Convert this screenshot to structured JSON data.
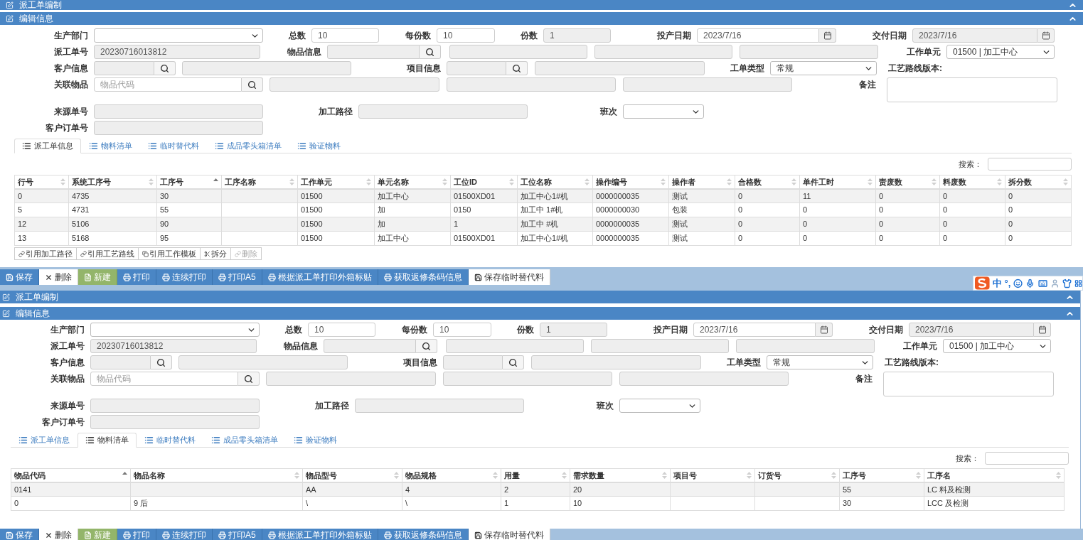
{
  "panels": [
    {
      "title": "派工单编制",
      "section": "编辑信息",
      "form": [
        [
          {
            "kind": "label",
            "text": "生产部门"
          },
          {
            "kind": "select"
          },
          {
            "kind": "label",
            "text": "总数"
          },
          {
            "kind": "input",
            "value": "10",
            "readonly": false
          },
          {
            "kind": "label",
            "text": "每份数"
          },
          {
            "kind": "input",
            "value": "10",
            "readonly": false
          },
          {
            "kind": "label",
            "text": "份数"
          },
          {
            "kind": "input",
            "value": "1",
            "readonly": true
          },
          {
            "kind": "label",
            "text": "投产日期"
          },
          {
            "kind": "date",
            "value": "2023/7/16",
            "readonly": false
          },
          {
            "kind": "label",
            "text": "交付日期"
          },
          {
            "kind": "date",
            "value": "2023/7/16",
            "readonly": true
          }
        ],
        [
          {
            "kind": "label",
            "text": "派工单号"
          },
          {
            "kind": "input",
            "value": "20230716013812",
            "readonly": true
          },
          {
            "kind": "label",
            "text": "物品信息"
          },
          {
            "kind": "lookup",
            "readonly": true
          },
          {
            "kind": "input",
            "readonly": true
          },
          {
            "kind": "input",
            "readonly": true
          },
          {
            "kind": "input",
            "readonly": true
          },
          {
            "kind": "label",
            "text": "工作单元"
          },
          {
            "kind": "select",
            "value": "01500 | 加工中心"
          }
        ],
        [
          {
            "kind": "label",
            "text": "客户信息"
          },
          {
            "kind": "lookup",
            "readonly": true
          },
          {
            "kind": "input",
            "readonly": true
          },
          {
            "kind": "label",
            "text": "项目信息"
          },
          {
            "kind": "lookup",
            "readonly": true
          },
          {
            "kind": "input",
            "readonly": true
          },
          {
            "kind": "label",
            "text": "工单类型"
          },
          {
            "kind": "select",
            "value": "常规"
          },
          {
            "kind": "label",
            "text": "工艺路线版本:"
          }
        ],
        [
          {
            "kind": "label",
            "text": "关联物品"
          },
          {
            "kind": "lookup",
            "placeholder": "物品代码",
            "readonly": false
          },
          {
            "kind": "input",
            "readonly": true
          },
          {
            "kind": "input",
            "readonly": true
          },
          {
            "kind": "input",
            "readonly": true
          },
          {
            "kind": "label",
            "text": "备注"
          },
          {
            "kind": "textarea"
          }
        ],
        [
          {
            "kind": "label",
            "text": "来源单号"
          },
          {
            "kind": "input",
            "readonly": true
          },
          {
            "kind": "label",
            "text": "加工路径"
          },
          {
            "kind": "input",
            "readonly": true
          },
          {
            "kind": "label",
            "text": "班次"
          },
          {
            "kind": "select"
          }
        ],
        [
          {
            "kind": "label",
            "text": "客户订单号"
          },
          {
            "kind": "input",
            "readonly": true
          }
        ]
      ],
      "tabs": [
        {
          "label": "派工单信息",
          "selected": true
        },
        {
          "label": "物料清单",
          "selected": false
        },
        {
          "label": "临时替代料",
          "selected": false
        },
        {
          "label": "成品零头箱清单",
          "selected": false
        },
        {
          "label": "验证物料",
          "selected": false
        }
      ],
      "search_label": "搜索：",
      "table": {
        "columns": [
          {
            "label": "行号",
            "sorted": false
          },
          {
            "label": "系统工序号",
            "sorted": false
          },
          {
            "label": "工序号",
            "sorted": true
          },
          {
            "label": "工序名称",
            "sorted": false
          },
          {
            "label": "工作单元",
            "sorted": false
          },
          {
            "label": "单元名称",
            "sorted": false
          },
          {
            "label": "工位ID",
            "sorted": false
          },
          {
            "label": "工位名称",
            "sorted": false
          },
          {
            "label": "操作编号",
            "sorted": false
          },
          {
            "label": "操作者",
            "sorted": false
          },
          {
            "label": "合格数",
            "sorted": false
          },
          {
            "label": "单件工时",
            "sorted": false
          },
          {
            "label": "责废数",
            "sorted": false
          },
          {
            "label": "料废数",
            "sorted": false
          },
          {
            "label": "拆分数",
            "sorted": false
          }
        ],
        "rows": [
          [
            "0",
            "4735",
            "30",
            "",
            "01500",
            "加工中心",
            "01500XD01",
            "加工中心1#机",
            "0000000035",
            "测试",
            "0",
            "11",
            "0",
            "0",
            "0"
          ],
          [
            "5",
            "4731",
            "55",
            "",
            "01500",
            "加",
            "0150",
            "加工中 1#机",
            "0000000030",
            "包装",
            "0",
            "0",
            "0",
            "0",
            "0"
          ],
          [
            "12",
            "5106",
            "90",
            "",
            "01500",
            "加",
            "1",
            "加工中 #机",
            "0000000035",
            "测试",
            "0",
            "0",
            "0",
            "0",
            "0"
          ],
          [
            "13",
            "5168",
            "95",
            "",
            "01500",
            "加工中心",
            "01500XD01",
            "加工中心1#机",
            "0000000035",
            "测试",
            "0",
            "0",
            "0",
            "0",
            "0"
          ]
        ]
      },
      "actions": [
        {
          "label": "引用加工路径",
          "disabled": false
        },
        {
          "label": "引用工艺路线",
          "disabled": false
        },
        {
          "label": "引用工作模板",
          "disabled": false
        },
        {
          "label": "拆分",
          "disabled": false
        },
        {
          "label": "删除",
          "disabled": true
        }
      ],
      "toolbar": [
        {
          "label": "保存",
          "kind": "primary"
        },
        {
          "label": "删除",
          "kind": "default"
        },
        {
          "label": "新建",
          "kind": "success"
        },
        {
          "label": "打印",
          "kind": "primary"
        },
        {
          "label": "连续打印",
          "kind": "primary"
        },
        {
          "label": "打印A5",
          "kind": "primary"
        },
        {
          "label": "根据派工单打印外箱标贴",
          "kind": "primary"
        },
        {
          "label": "获取返修条码信息",
          "kind": "primary"
        },
        {
          "label": "保存临时替代料",
          "kind": "default"
        }
      ],
      "ime": [
        "中",
        "°,"
      ]
    },
    {
      "title": "派工单编制",
      "section": "编辑信息",
      "form": [
        [
          {
            "kind": "label",
            "text": "生产部门"
          },
          {
            "kind": "select"
          },
          {
            "kind": "label",
            "text": "总数"
          },
          {
            "kind": "input",
            "value": "10",
            "readonly": false
          },
          {
            "kind": "label",
            "text": "每份数"
          },
          {
            "kind": "input",
            "value": "10",
            "readonly": false
          },
          {
            "kind": "label",
            "text": "份数"
          },
          {
            "kind": "input",
            "value": "1",
            "readonly": true
          },
          {
            "kind": "label",
            "text": "投产日期"
          },
          {
            "kind": "date",
            "value": "2023/7/16",
            "readonly": false
          },
          {
            "kind": "label",
            "text": "交付日期"
          },
          {
            "kind": "date",
            "value": "2023/7/16",
            "readonly": true
          }
        ],
        [
          {
            "kind": "label",
            "text": "派工单号"
          },
          {
            "kind": "input",
            "value": "20230716013812",
            "readonly": true
          },
          {
            "kind": "label",
            "text": "物品信息"
          },
          {
            "kind": "lookup",
            "readonly": true
          },
          {
            "kind": "input",
            "readonly": true
          },
          {
            "kind": "input",
            "readonly": true
          },
          {
            "kind": "input",
            "readonly": true
          },
          {
            "kind": "label",
            "text": "工作单元"
          },
          {
            "kind": "select",
            "value": "01500 | 加工中心"
          }
        ],
        [
          {
            "kind": "label",
            "text": "客户信息"
          },
          {
            "kind": "lookup",
            "readonly": true
          },
          {
            "kind": "input",
            "readonly": true
          },
          {
            "kind": "label",
            "text": "项目信息"
          },
          {
            "kind": "lookup",
            "readonly": true
          },
          {
            "kind": "input",
            "readonly": true
          },
          {
            "kind": "label",
            "text": "工单类型"
          },
          {
            "kind": "select",
            "value": "常规"
          },
          {
            "kind": "label",
            "text": "工艺路线版本:"
          }
        ],
        [
          {
            "kind": "label",
            "text": "关联物品"
          },
          {
            "kind": "lookup",
            "placeholder": "物品代码",
            "readonly": false
          },
          {
            "kind": "input",
            "readonly": true
          },
          {
            "kind": "input",
            "readonly": true
          },
          {
            "kind": "input",
            "readonly": true
          },
          {
            "kind": "label",
            "text": "备注"
          },
          {
            "kind": "textarea"
          }
        ],
        [
          {
            "kind": "label",
            "text": "来源单号"
          },
          {
            "kind": "input",
            "readonly": true
          },
          {
            "kind": "label",
            "text": "加工路径"
          },
          {
            "kind": "input",
            "readonly": true
          },
          {
            "kind": "label",
            "text": "班次"
          },
          {
            "kind": "select"
          }
        ],
        [
          {
            "kind": "label",
            "text": "客户订单号"
          },
          {
            "kind": "input",
            "readonly": true
          }
        ]
      ],
      "tabs": [
        {
          "label": "派工单信息",
          "selected": false
        },
        {
          "label": "物料清单",
          "selected": true
        },
        {
          "label": "临时替代料",
          "selected": false
        },
        {
          "label": "成品零头箱清单",
          "selected": false
        },
        {
          "label": "验证物料",
          "selected": false
        }
      ],
      "search_label": "搜索：",
      "table": {
        "columns": [
          {
            "label": "物品代码",
            "sorted": true
          },
          {
            "label": "物品名称",
            "sorted": false
          },
          {
            "label": "物品型号",
            "sorted": false
          },
          {
            "label": "物品规格",
            "sorted": false
          },
          {
            "label": "用量",
            "sorted": false
          },
          {
            "label": "需求数量",
            "sorted": false
          },
          {
            "label": "项目号",
            "sorted": false
          },
          {
            "label": "订货号",
            "sorted": false
          },
          {
            "label": "工序号",
            "sorted": false
          },
          {
            "label": "工序名",
            "sorted": false
          }
        ],
        "rows": [
          [
            "0141",
            "",
            "AA",
            "4",
            "2",
            "20",
            "",
            "",
            "55",
            "LC 料及检测"
          ],
          [
            "0",
            "9 后",
            "\\",
            "\\",
            "1",
            "10",
            "",
            "",
            "30",
            "LCC 及检测"
          ]
        ]
      },
      "toolbar": [
        {
          "label": "保存",
          "kind": "primary"
        },
        {
          "label": "删除",
          "kind": "default"
        },
        {
          "label": "新建",
          "kind": "success"
        },
        {
          "label": "打印",
          "kind": "primary"
        },
        {
          "label": "连续打印",
          "kind": "primary"
        },
        {
          "label": "打印A5",
          "kind": "primary"
        },
        {
          "label": "根据派工单打印外箱标贴",
          "kind": "primary"
        },
        {
          "label": "获取返修条码信息",
          "kind": "primary"
        },
        {
          "label": "保存临时替代料",
          "kind": "default"
        }
      ]
    }
  ]
}
